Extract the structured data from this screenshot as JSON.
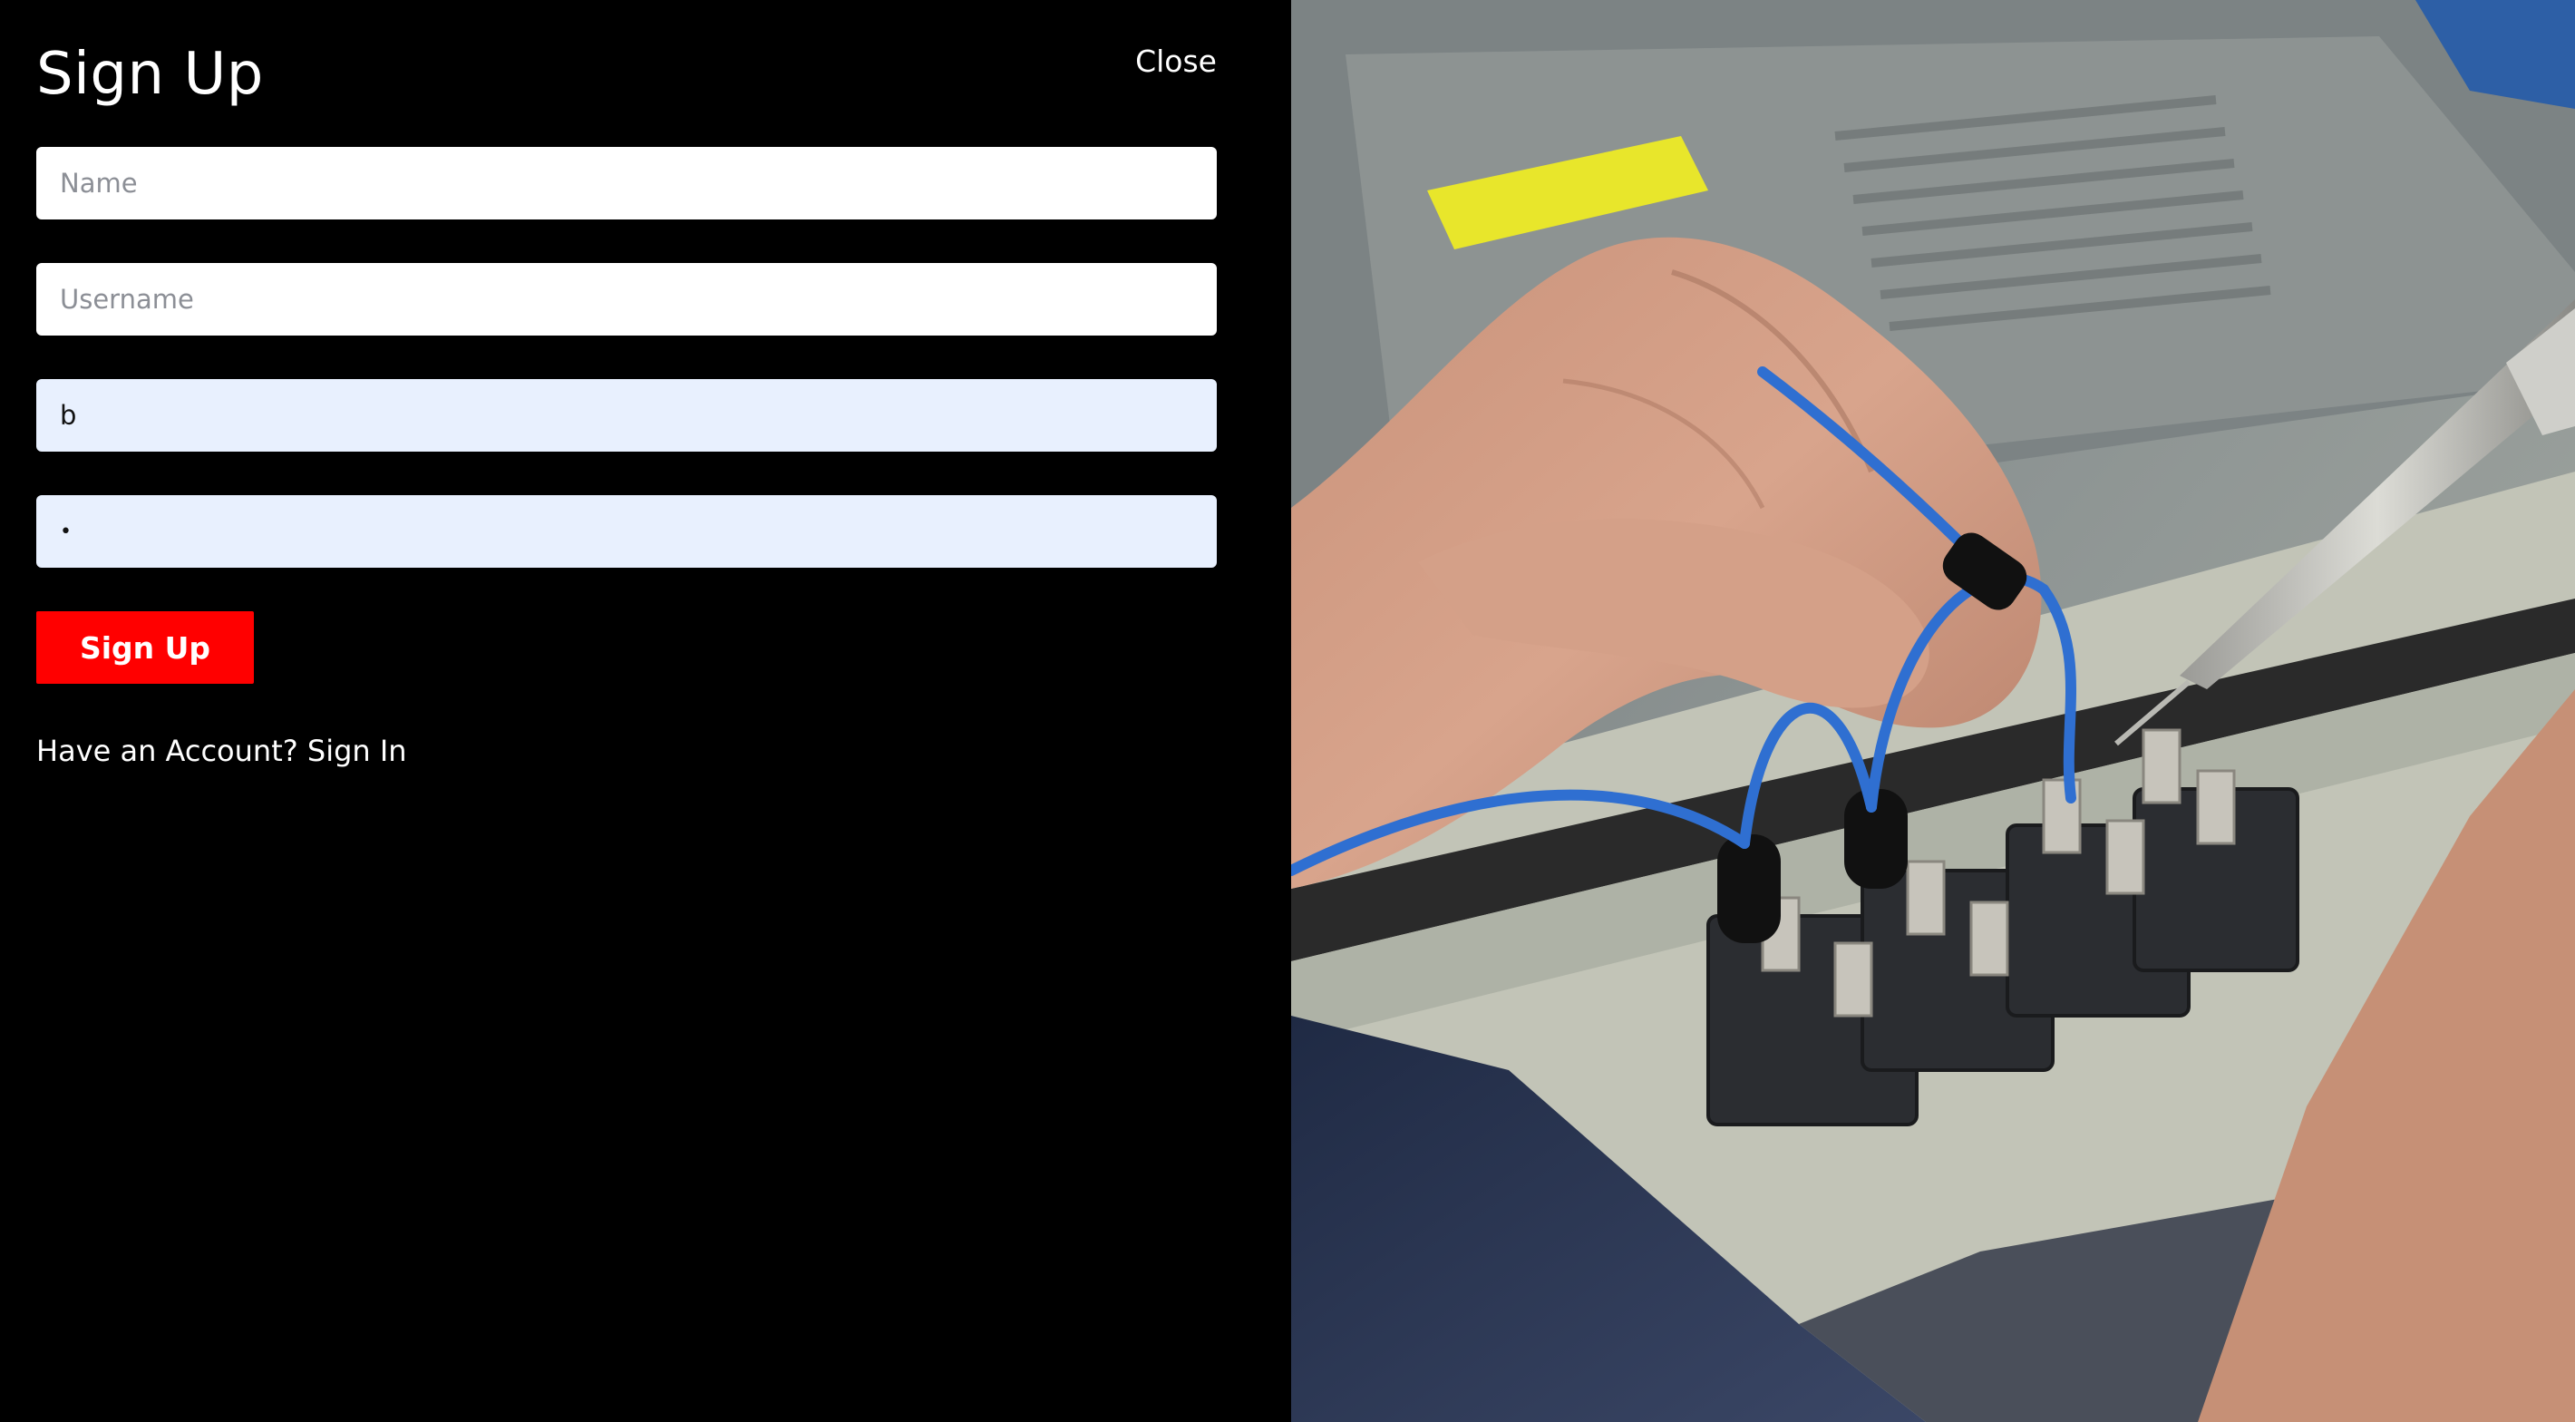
{
  "form": {
    "title": "Sign Up",
    "close_label": "Close",
    "name_placeholder": "Name",
    "username_placeholder": "Username",
    "email_value": "b",
    "password_value": "•",
    "submit_label": "Sign Up",
    "have_account_text": "Have an Account?",
    "sign_in_label": "Sign In"
  },
  "colors": {
    "panel_bg": "#000000",
    "submit_bg": "#ff0000",
    "autofill_bg": "#e8f0fe"
  },
  "hero_image": {
    "description_icon": "photo-soldering-wires-on-switches"
  }
}
